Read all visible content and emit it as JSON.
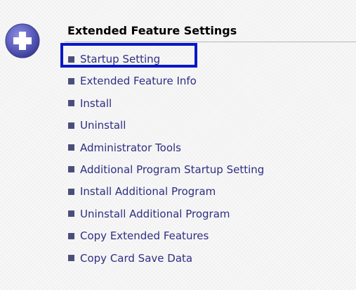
{
  "panel": {
    "title": "Extended Feature Settings",
    "icon": "plus-icon",
    "icon_color": "#5e5fbf"
  },
  "menu": {
    "items": [
      {
        "label": "Startup Setting",
        "selected": true
      },
      {
        "label": "Extended Feature Info"
      },
      {
        "label": "Install"
      },
      {
        "label": "Uninstall"
      },
      {
        "label": "Administrator Tools"
      },
      {
        "label": "Additional Program Startup Setting"
      },
      {
        "label": "Install Additional Program"
      },
      {
        "label": "Uninstall Additional Program"
      },
      {
        "label": "Copy Extended Features"
      },
      {
        "label": "Copy Card Save Data"
      }
    ]
  },
  "colors": {
    "link_text": "#2e2e84",
    "bullet": "#4a4f7a",
    "selection_frame": "#0618c8"
  }
}
